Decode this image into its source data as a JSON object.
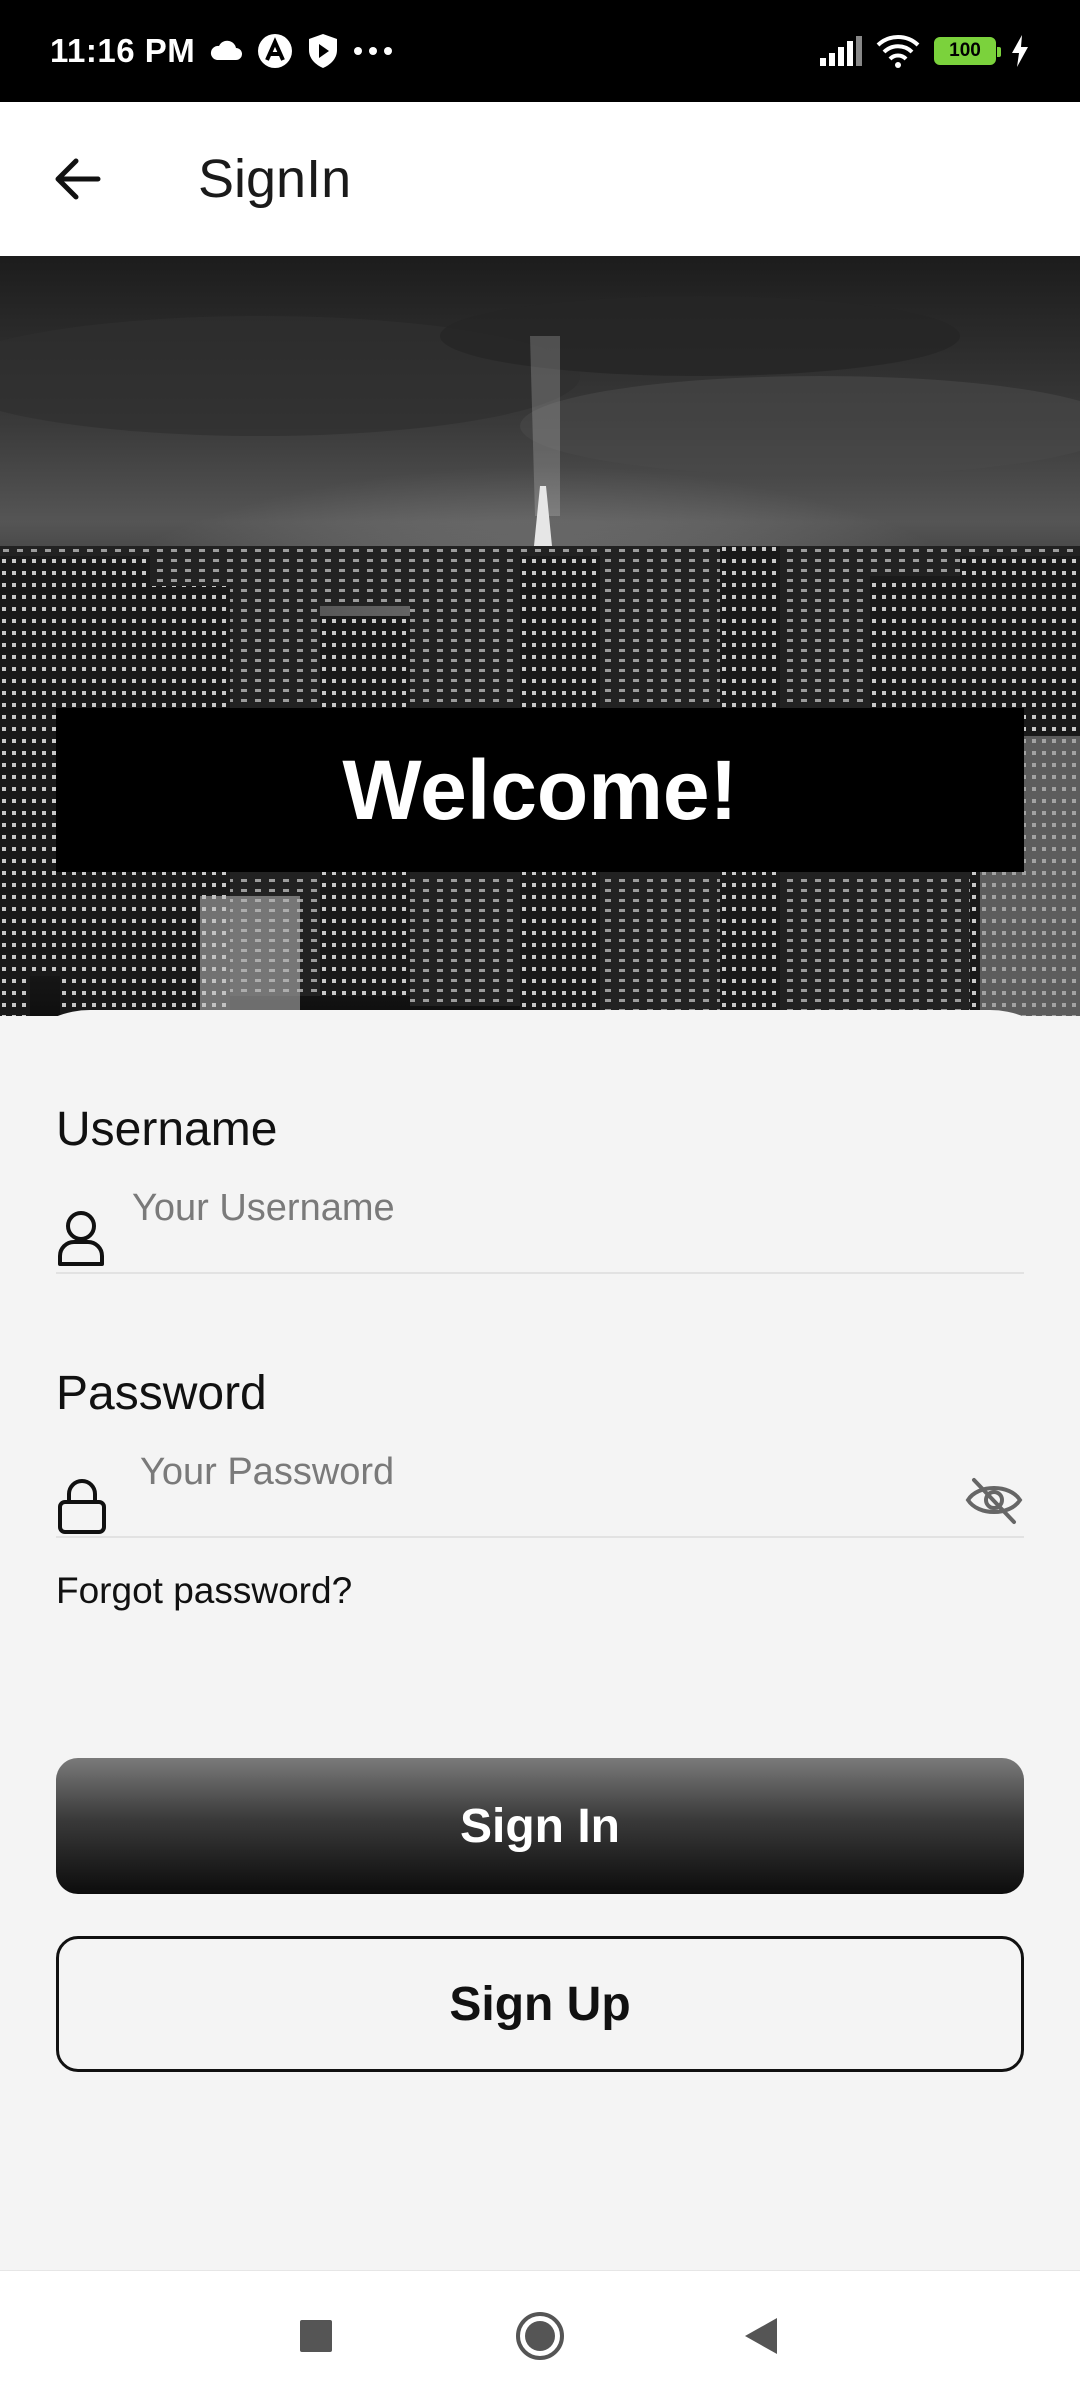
{
  "status_bar": {
    "time": "11:16 PM",
    "battery": "100",
    "icons": [
      "cloud-icon",
      "app-a-icon",
      "shield-play-icon",
      "more-dots-icon",
      "signal-icon",
      "wifi-icon",
      "battery-icon",
      "charging-icon"
    ]
  },
  "app_bar": {
    "title": "SignIn",
    "back_icon": "arrow-left-icon"
  },
  "hero": {
    "welcome": "Welcome!"
  },
  "form": {
    "username": {
      "label": "Username",
      "placeholder": "Your Username",
      "value": "",
      "icon": "user-icon"
    },
    "password": {
      "label": "Password",
      "placeholder": "Your Password",
      "value": "",
      "icon": "lock-icon",
      "toggle_icon": "eye-off-icon"
    },
    "forgot_label": "Forgot password?",
    "signin_label": "Sign In",
    "signup_label": "Sign Up"
  },
  "nav_bar": {
    "icons": [
      "recents-square-icon",
      "home-circle-icon",
      "back-triangle-icon"
    ]
  },
  "colors": {
    "background": "#f4f4f4",
    "primary": "#000000",
    "battery": "#7bd23c"
  }
}
